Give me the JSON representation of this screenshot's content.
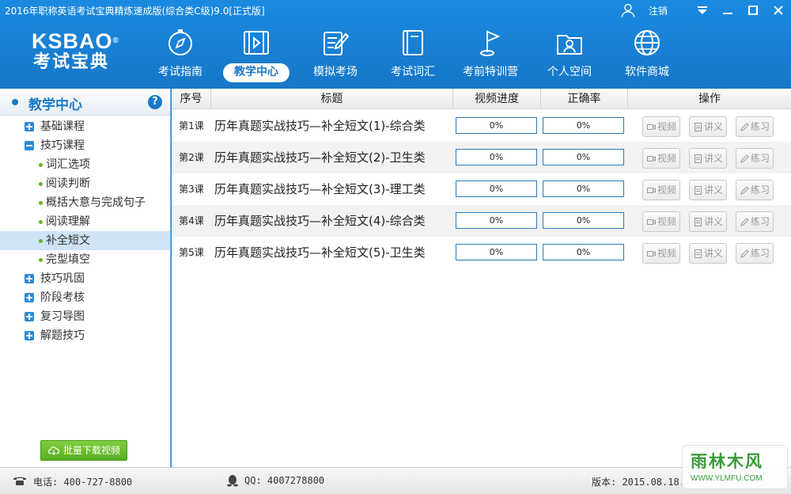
{
  "window": {
    "title": "2016年职称英语考试宝典精炼速成版(综合类C级)9.0[正式版]",
    "logout_label": "注销"
  },
  "logo": {
    "text": "KSBAO",
    "reg": "®",
    "cn": "考试宝典"
  },
  "nav": [
    {
      "label": "考试指南",
      "icon": "compass-icon"
    },
    {
      "label": "教学中心",
      "icon": "video-icon",
      "active": true
    },
    {
      "label": "模拟考场",
      "icon": "exam-paper-icon"
    },
    {
      "label": "考试词汇",
      "icon": "book-icon"
    },
    {
      "label": "考前特训营",
      "icon": "flag-icon"
    },
    {
      "label": "个人空间",
      "icon": "person-folder-icon"
    },
    {
      "label": "软件商城",
      "icon": "globe-icon"
    }
  ],
  "sidebar": {
    "title": "教学中心",
    "help_label": "?",
    "items": [
      {
        "label": "基础课程",
        "type": "group",
        "expanded": false
      },
      {
        "label": "技巧课程",
        "type": "group",
        "expanded": true
      },
      {
        "label": "词汇选项",
        "type": "child"
      },
      {
        "label": "阅读判断",
        "type": "child"
      },
      {
        "label": "概括大意与完成句子",
        "type": "child"
      },
      {
        "label": "阅读理解",
        "type": "child"
      },
      {
        "label": "补全短文",
        "type": "child",
        "selected": true
      },
      {
        "label": "完型填空",
        "type": "child"
      },
      {
        "label": "技巧巩固",
        "type": "group",
        "expanded": false
      },
      {
        "label": "阶段考核",
        "type": "group",
        "expanded": false
      },
      {
        "label": "复习导图",
        "type": "group",
        "expanded": false
      },
      {
        "label": "解题技巧",
        "type": "group",
        "expanded": false
      }
    ],
    "download_label": "批量下载视频"
  },
  "table": {
    "headers": [
      "序号",
      "标题",
      "视频进度",
      "正确率",
      "操作"
    ],
    "rows": [
      {
        "no": "第1课",
        "title": "历年真题实战技巧—补全短文(1)-综合类",
        "video_progress": "0%",
        "accuracy": "0%"
      },
      {
        "no": "第2课",
        "title": "历年真题实战技巧—补全短文(2)-卫生类",
        "video_progress": "0%",
        "accuracy": "0%"
      },
      {
        "no": "第3课",
        "title": "历年真题实战技巧—补全短文(3)-理工类",
        "video_progress": "0%",
        "accuracy": "0%"
      },
      {
        "no": "第4课",
        "title": "历年真题实战技巧—补全短文(4)-综合类",
        "video_progress": "0%",
        "accuracy": "0%"
      },
      {
        "no": "第5课",
        "title": "历年真题实战技巧—补全短文(5)-卫生类",
        "video_progress": "0%",
        "accuracy": "0%"
      }
    ],
    "actions": {
      "video": "视频",
      "notes": "讲义",
      "practice": "练习"
    }
  },
  "footer": {
    "phone": "电话: 400-727-8800",
    "qq": "QQ: 4007278800",
    "version": "版本: 2015.08.18."
  },
  "watermark": {
    "cn": "雨林木风",
    "url": "WWW.YLMFU.COM"
  },
  "colors": {
    "header_blue": "#1a8ae0",
    "accent_green": "#66b32e",
    "download_green": "#58ad22"
  }
}
